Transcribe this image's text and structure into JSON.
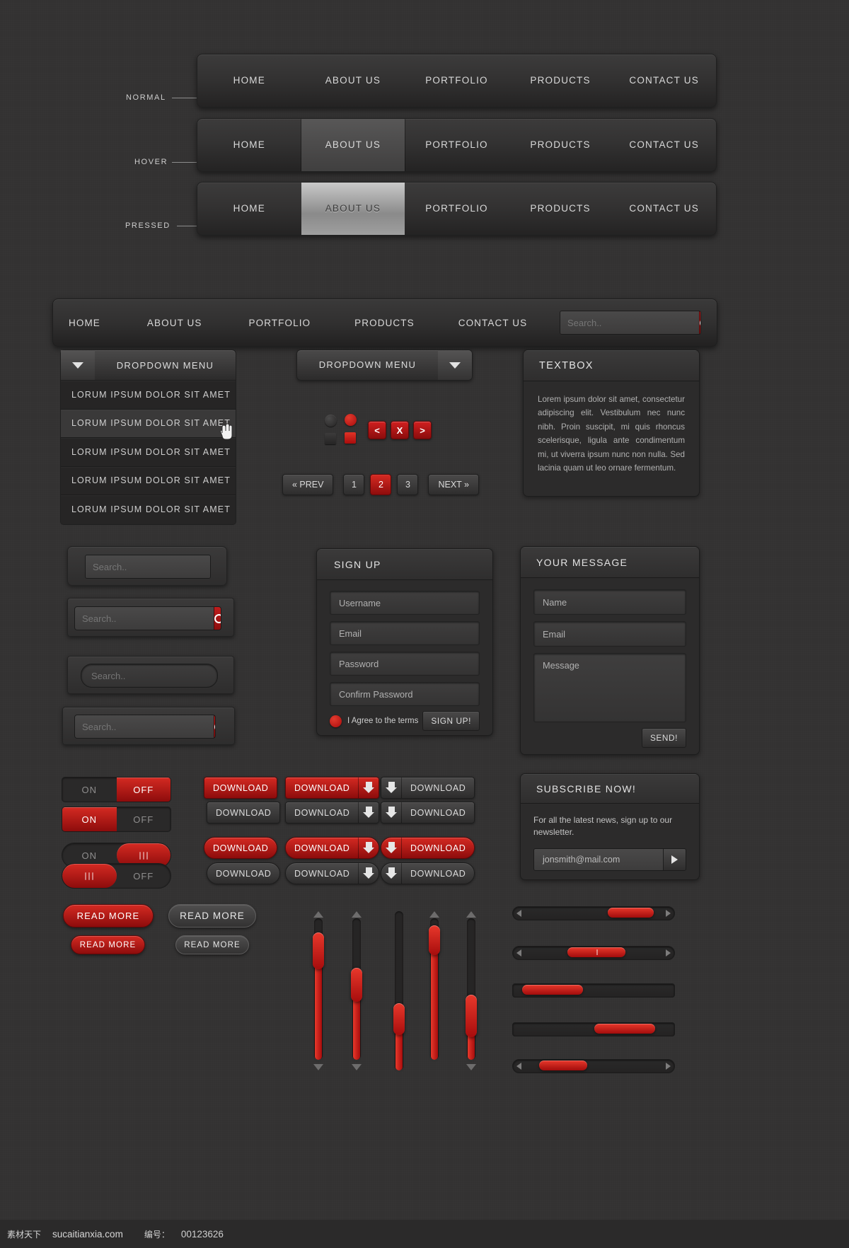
{
  "menu_items": [
    "HOME",
    "ABOUT US",
    "PORTFOLIO",
    "PRODUCTS",
    "CONTACT US"
  ],
  "states": {
    "normal": "NORMAL",
    "hover": "HOVER",
    "pressed": "PRESSED"
  },
  "search": {
    "placeholder": "Search..",
    "icon": "search-icon"
  },
  "dropdown": {
    "title": "DROPDOWN MENU",
    "arrow_icon": "caret-down-icon",
    "items": [
      "LORUM IPSUM DOLOR SIT AMET",
      "LORUM IPSUM DOLOR SIT AMET",
      "LORUM IPSUM DOLOR SIT AMET",
      "LORUM IPSUM DOLOR SIT AMET",
      "LORUM IPSUM DOLOR SIT AMET"
    ]
  },
  "mini_buttons": [
    {
      "label": "<",
      "name": "prev-arrow-button"
    },
    {
      "label": "X",
      "name": "close-button"
    },
    {
      "label": ">",
      "name": "next-arrow-button"
    }
  ],
  "pagination": {
    "prev": "« PREV",
    "pages": [
      "1",
      "2",
      "3"
    ],
    "active": "2",
    "next": "NEXT »"
  },
  "textbox": {
    "title": "TEXTBOX",
    "body": "Lorem ipsum dolor sit amet, consectetur adipiscing elit. Vestibulum nec nunc nibh. Proin suscipit, mi quis rhoncus scelerisque, ligula ante condimentum mi, ut viverra ipsum nunc non nulla. Sed lacinia quam ut leo ornare fermentum."
  },
  "signup": {
    "title": "SIGN UP",
    "username_placeholder": "Username",
    "email_placeholder": "Email",
    "password_placeholder": "Password",
    "confirm_placeholder": "Confirm Password",
    "agree_label": "I Agree to the terms",
    "submit_label": "SIGN UP!"
  },
  "message": {
    "title": "YOUR MESSAGE",
    "name_placeholder": "Name",
    "email_placeholder": "Email",
    "message_placeholder": "Message",
    "send_label": "SEND!"
  },
  "subscribe": {
    "title": "SUBSCRIBE NOW!",
    "blurb": "For all the latest news, sign up to our newsletter.",
    "email_value": "jonsmith@mail.com",
    "button_icon": "play-arrow-icon"
  },
  "toggle": {
    "on": "ON",
    "off": "OFF"
  },
  "download": {
    "label": "DOWNLOAD",
    "icon": "download-arrow-icon"
  },
  "read_more": {
    "label": "READ MORE"
  },
  "colors": {
    "accent_red": "#c81f1f",
    "accent_red_light": "#e8382b",
    "accent_red_dark": "#8d0c0c",
    "background": "#333232",
    "panel": "#2c2b2b",
    "text": "#d9d9d9"
  },
  "footer": {
    "site_label": "素材天下",
    "site_url": "sucaitianxia.com",
    "code_label": "编号：",
    "code_value": "00123626"
  }
}
